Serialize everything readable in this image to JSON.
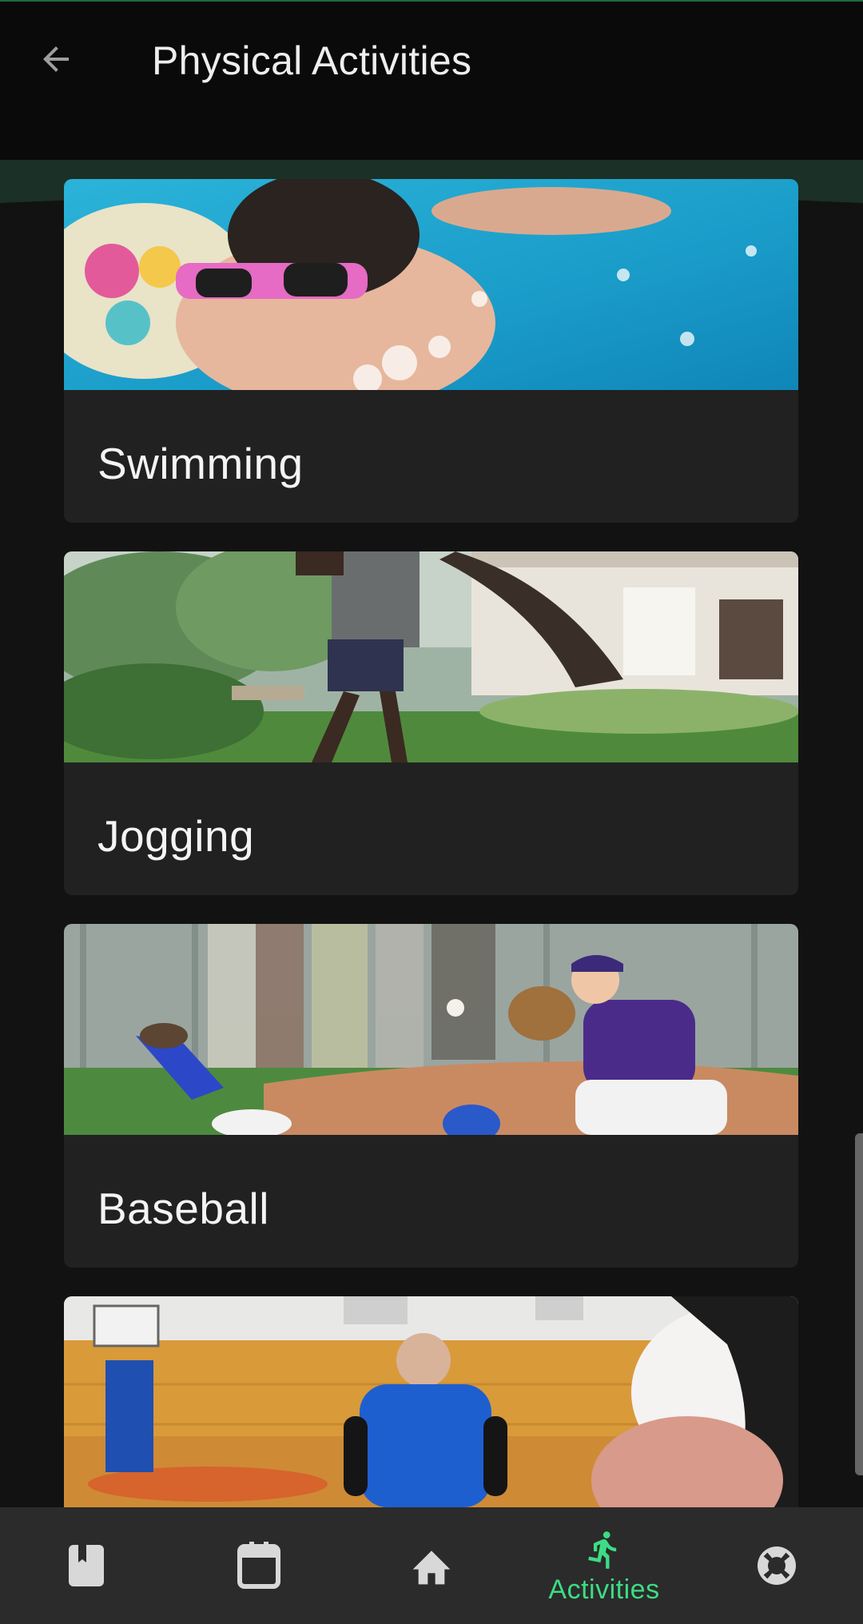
{
  "app_bar": {
    "title": "Physical Activities",
    "back_icon": "arrow-left-icon"
  },
  "activities": [
    {
      "label": "Swimming",
      "image": "child swimming in pool with pink sunglasses"
    },
    {
      "label": "Jogging",
      "image": "person jogging on lawn near house"
    },
    {
      "label": "Baseball",
      "image": "baseball player catching ball, runner sliding"
    },
    {
      "label": "",
      "image": "basketball coach in indoor gym"
    }
  ],
  "bottom_nav": {
    "items": [
      {
        "icon": "book-icon",
        "label": ""
      },
      {
        "icon": "calendar-icon",
        "label": ""
      },
      {
        "icon": "home-icon",
        "label": ""
      },
      {
        "icon": "running-person-icon",
        "label": "Activities"
      },
      {
        "icon": "lifebuoy-icon",
        "label": ""
      }
    ],
    "active_index": 3
  },
  "colors": {
    "background": "#121212",
    "app_bar": "#0a0a0a",
    "card": "#212121",
    "accent": "#3ddc84",
    "nav_bar": "#2b2b2b",
    "icon_inactive": "#d8d8d8"
  }
}
